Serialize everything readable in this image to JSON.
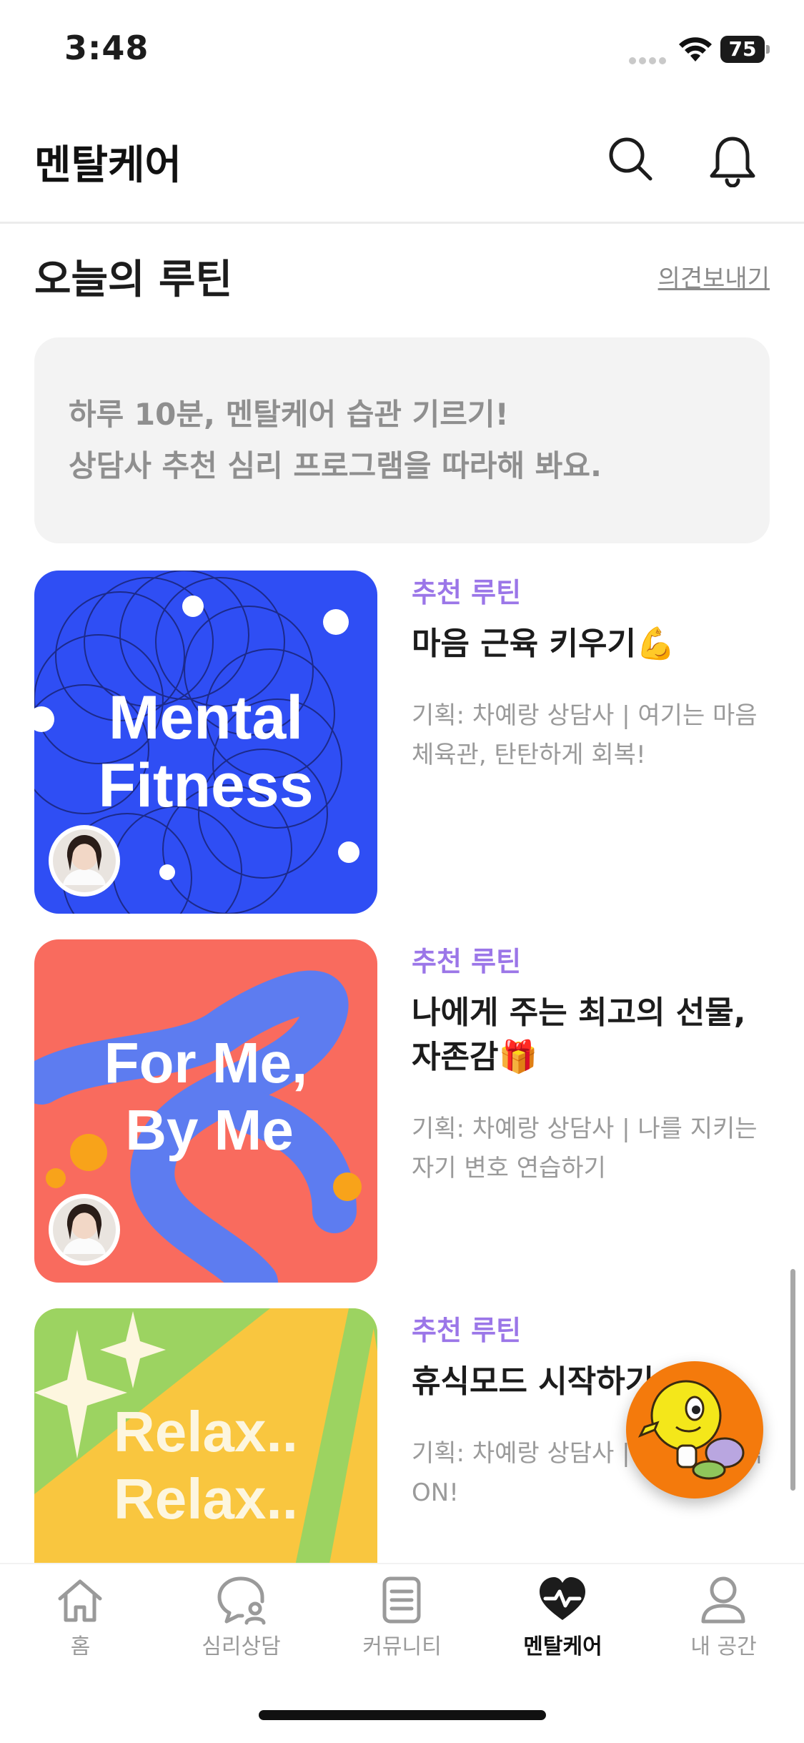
{
  "status_bar": {
    "time": "3:48",
    "battery": "75"
  },
  "app_bar": {
    "title": "멘탈케어",
    "icons": [
      "search-icon",
      "bell-icon"
    ]
  },
  "section": {
    "title": "오늘의 루틴",
    "feedback_link": "의견보내기"
  },
  "intro": {
    "line1": "하루 10분, 멘탈케어 습관 기르기!",
    "line2": "상담사 추천 심리 프로그램을 따라해 봐요."
  },
  "routines": [
    {
      "tag": "추천 루틴",
      "title": "마음 근육 키우기💪",
      "desc": "기획: 차예랑 상담사 | 여기는 마음 체육관, 탄탄하게 회복!",
      "thumb_text": [
        "Mental",
        "Fitness"
      ],
      "thumb_bg": "#2f4ef4"
    },
    {
      "tag": "추천 루틴",
      "title": "나에게 주는 최고의 선물, 자존감🎁",
      "desc": "기획: 차예랑 상담사 | 나를 지키는 자기 변호 연습하기",
      "thumb_text": [
        "For Me,",
        "By Me"
      ],
      "thumb_bg": "#f96b5e"
    },
    {
      "tag": "추천 루틴",
      "title": "휴식모드 시작하기",
      "desc": "기획: 차예랑 상담사 | 잘 가~ 휴식 ON!",
      "thumb_text": [
        "Relax..",
        "Relax.."
      ],
      "thumb_bg": "#f9c63f"
    }
  ],
  "tabs": [
    {
      "label": "홈",
      "icon": "home-icon",
      "active": false
    },
    {
      "label": "심리상담",
      "icon": "counseling-icon",
      "active": false
    },
    {
      "label": "커뮤니티",
      "icon": "community-icon",
      "active": false
    },
    {
      "label": "멘탈케어",
      "icon": "heart-pulse-icon",
      "active": true
    },
    {
      "label": "내 공간",
      "icon": "person-icon",
      "active": false
    }
  ],
  "colors": {
    "accent": "#9b76e8",
    "fab": "#f47a0c",
    "text": "#1c1c1c",
    "muted": "#9a9a9a"
  }
}
